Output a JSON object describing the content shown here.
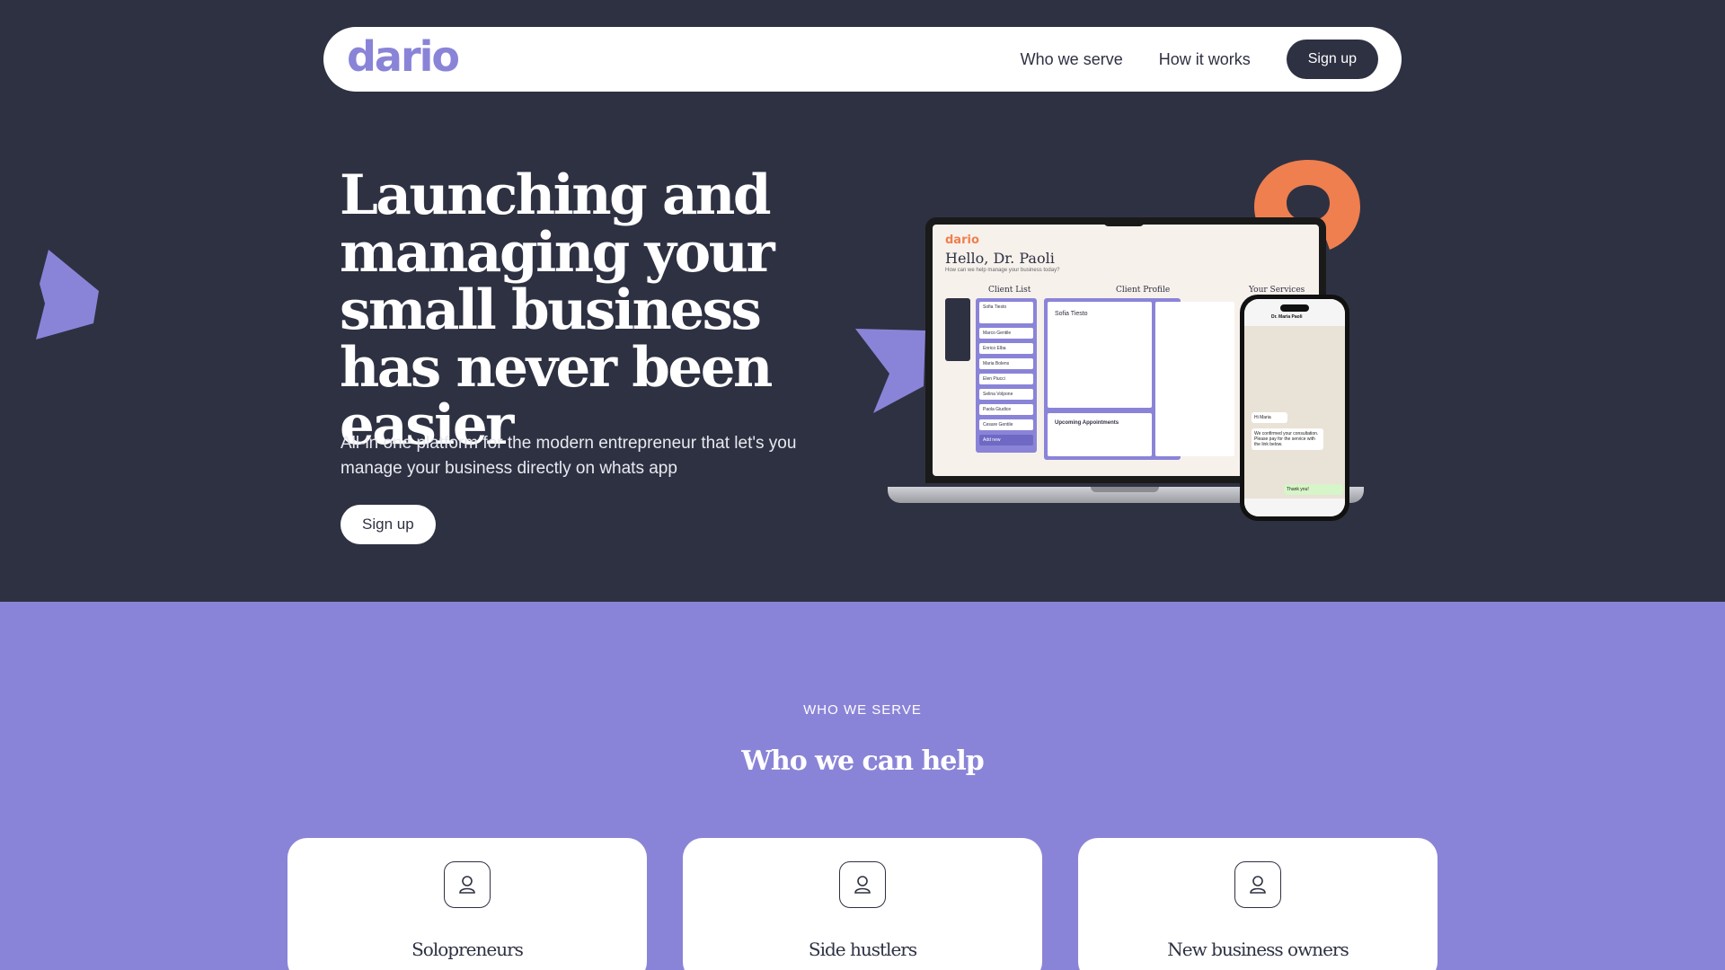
{
  "brand": {
    "logo_text": "dario",
    "accent": "#8a84d8",
    "orange": "#ef7f4e",
    "dark": "#2e3142"
  },
  "nav": {
    "links": [
      "Who we serve",
      "How it works"
    ],
    "signup_label": "Sign up"
  },
  "hero": {
    "title": "Launching and managing your small business has never been easier",
    "subtitle": "All-in one platform for the modern entrepreneur that let's you manage your business directly on whats app",
    "cta_label": "Sign up"
  },
  "mockup": {
    "logo": "dario",
    "greeting": "Hello, Dr. Paoli",
    "question": "How can we help manage your business today?",
    "columns": [
      "Client List",
      "Client Profile",
      "Your Services"
    ],
    "clients": [
      "Sofia Tiesto",
      "Marco Gentile",
      "Enrico Elba",
      "Maria Bolens",
      "Elen Piucci",
      "Selina Volpone",
      "Paola Giudice",
      "Cesare Gentile"
    ],
    "add_label": "Add new",
    "profile_name": "Sofia Tiesto",
    "appointments_title": "Upcoming Appointments",
    "phone_contact": "Dr. Maria Paoli",
    "phone_messages": [
      "Hi Maria",
      "We confirmed your consultation. Please pay for the service with the link below.",
      "Thank you!"
    ]
  },
  "serve": {
    "eyebrow": "WHO WE SERVE",
    "title": "Who we can help",
    "cards": [
      {
        "title": "Solopreneurs",
        "icon": "user-icon"
      },
      {
        "title": "Side hustlers",
        "icon": "user-icon"
      },
      {
        "title": "New business owners",
        "icon": "user-icon"
      }
    ]
  }
}
